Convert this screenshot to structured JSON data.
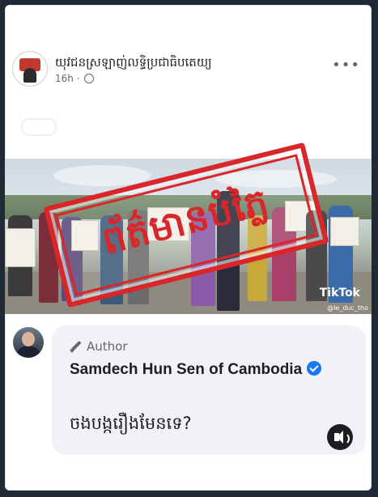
{
  "post": {
    "page_name": "យុវជនស្រឡាញ់លទ្ធិប្រជាធិបតេយ្យ",
    "time": "16h ·",
    "more_label": "•••",
    "stamp_text": "ព័ត៌មានបំភ្លៃ",
    "watermark_logo": "TikTok",
    "watermark_user": "@le_duc_tho"
  },
  "comment": {
    "author_badge": "Author",
    "name": "Samdech Hun Sen of Cambodia",
    "text": "ចងបង្ករឿងមែនទេ?"
  },
  "colors": {
    "stamp_red": "#d92629",
    "verified_blue": "#1877f2",
    "bubble_bg": "#f0f2f5",
    "frame_bg": "#1f2a36"
  },
  "icons": {
    "globe": "globe-icon",
    "more": "more-icon",
    "pen": "pen-icon",
    "verified": "verified-badge-icon",
    "audio": "speaker-icon"
  }
}
